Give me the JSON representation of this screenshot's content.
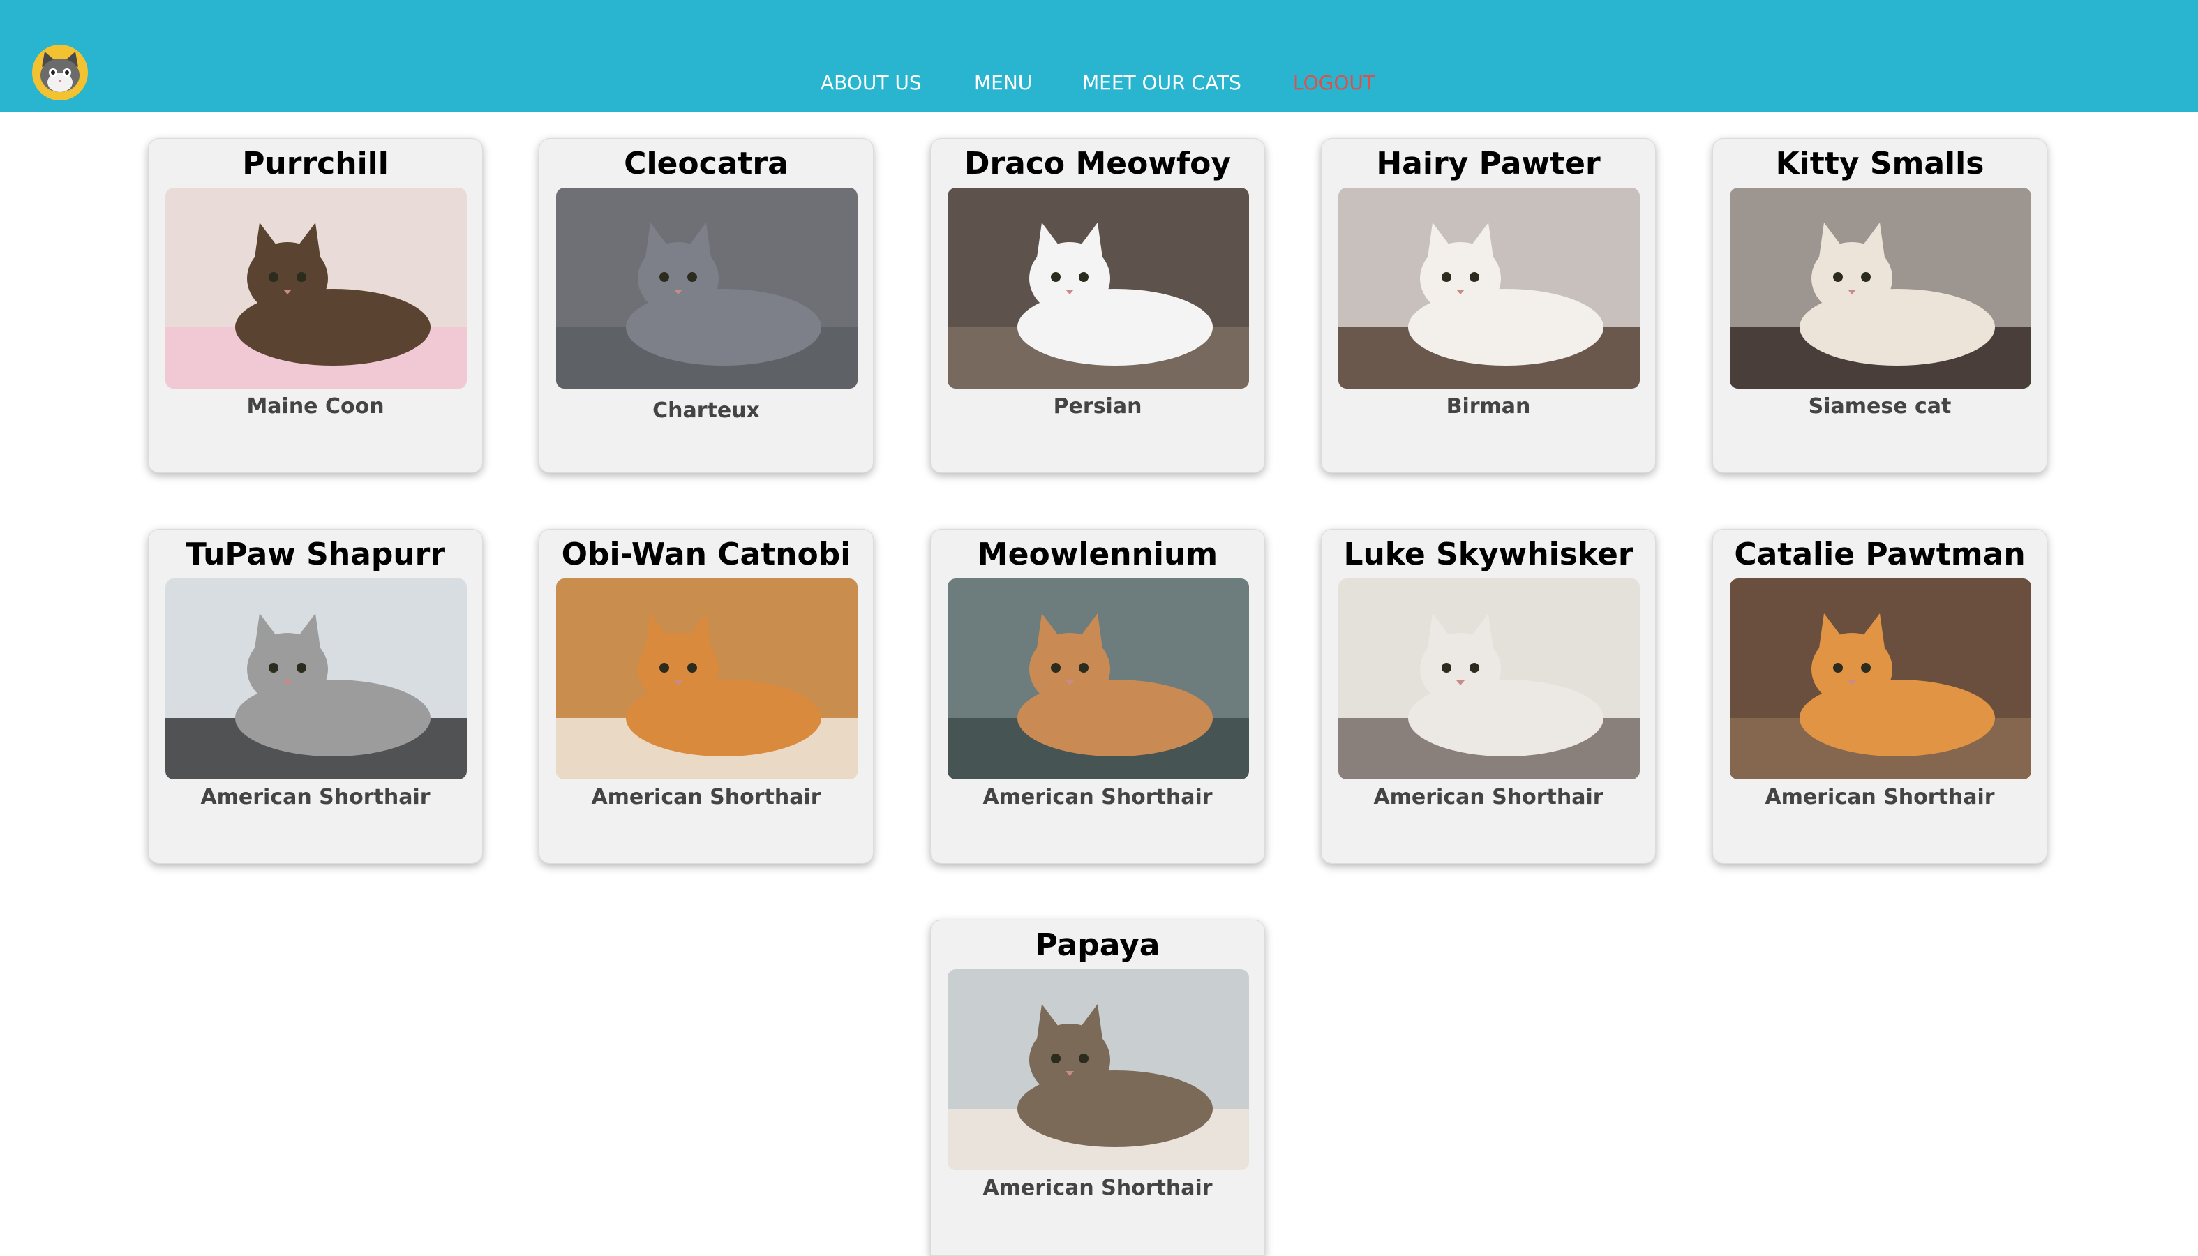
{
  "nav": {
    "logo_icon": "cat-face-logo-icon",
    "links": [
      {
        "label": "ABOUT US"
      },
      {
        "label": "MENU"
      },
      {
        "label": "MEET OUR CATS"
      },
      {
        "label": "LOGOUT"
      }
    ]
  },
  "colors": {
    "navbar": "#29b5d0",
    "logout": "#e0504a",
    "card_bg": "#f1f1f1",
    "name_text": "#000000",
    "breed_text": "#444444"
  },
  "cats": [
    {
      "name": "Purrchill",
      "breed": "Maine Coon",
      "photo": "maine-coon-photo",
      "bg": "#e9dcd8",
      "fur": "#5a4330",
      "accent": "#f2c6d3"
    },
    {
      "name": "Cleocatra",
      "breed": "Charteux",
      "photo": "grey-cat-photo",
      "bg": "#6e7075",
      "fur": "#7d8088",
      "accent": "#5c5f64"
    },
    {
      "name": "Draco Meowfoy",
      "breed": "Persian",
      "photo": "white-persian-photo",
      "bg": "#5e534c",
      "fur": "#f4f4f4",
      "accent": "#7b6d62"
    },
    {
      "name": "Hairy Pawter",
      "breed": "Birman",
      "photo": "birman-photo",
      "bg": "#c7c0bc",
      "fur": "#f3efea",
      "accent": "#5a4538"
    },
    {
      "name": "Kitty Smalls",
      "breed": "Siamese cat",
      "photo": "siamese-photo",
      "bg": "#9c9590",
      "fur": "#ece4d8",
      "accent": "#3b2f2a"
    },
    {
      "name": "TuPaw Shapurr",
      "breed": "American Shorthair",
      "photo": "silver-tabby-photo",
      "bg": "#d8dde2",
      "fur": "#9c9c9c",
      "accent": "#3a3a3a"
    },
    {
      "name": "Obi-Wan Catnobi",
      "breed": "American Shorthair",
      "photo": "orange-cat-kitchen-photo",
      "bg": "#c98d4e",
      "fur": "#d98a3c",
      "accent": "#f0e6da"
    },
    {
      "name": "Meowlennium",
      "breed": "American Shorthair",
      "photo": "ginger-cat-rolling-photo",
      "bg": "#6d7c7c",
      "fur": "#c98a54",
      "accent": "#3f4d4d"
    },
    {
      "name": "Luke Skywhisker",
      "breed": "American Shorthair",
      "photo": "white-cat-photo",
      "bg": "#e3e1da",
      "fur": "#ece8e4",
      "accent": "#7a6f6a"
    },
    {
      "name": "Catalie Pawtman",
      "breed": "American Shorthair",
      "photo": "orange-tabby-floor-photo",
      "bg": "#6a4f3e",
      "fur": "#e19444",
      "accent": "#8a6a52"
    },
    {
      "name": "Papaya",
      "breed": "American Shorthair",
      "photo": "brown-tabby-photo",
      "bg": "#c9ced1",
      "fur": "#7b6a58",
      "accent": "#efe6de"
    }
  ]
}
